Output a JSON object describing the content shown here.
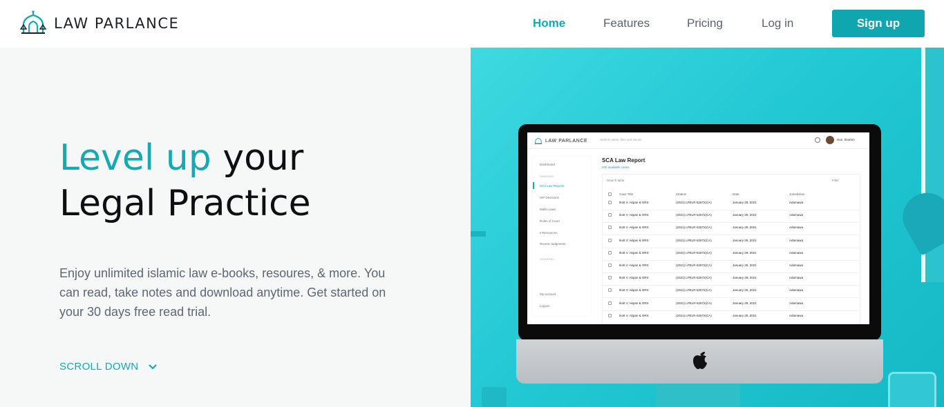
{
  "header": {
    "brand": "LAW PARLANCE",
    "nav": [
      {
        "label": "Home",
        "active": true
      },
      {
        "label": "Features",
        "active": false
      },
      {
        "label": "Pricing",
        "active": false
      },
      {
        "label": "Log in",
        "active": false
      }
    ],
    "signup_label": "Sign up"
  },
  "hero": {
    "headline_highlight": "Level up",
    "headline_rest": "your",
    "headline_line2": "Legal Practice",
    "description": "Enjoy unlimited islamic law e-books, resoures, & more. You can read, take notes and download anytime. Get started on your 30 days free read trial.",
    "scroll_label": "SCROLL DOWN"
  },
  "screen": {
    "brand": "LAW PARLANCE",
    "search_placeholder": "Search cases, files and issues",
    "user_name": "Hon. Ibrahim",
    "sidebar": {
      "dashboard": "Dashboard",
      "section_sharia": "SHARIAH",
      "items": [
        "SCA Law Reports",
        "ISP Decisions",
        "Maliki Laws",
        "Rules of Court",
        "e-Resources",
        "Recent Judgments"
      ],
      "section_general": "GENERAL",
      "my_account": "My Account",
      "logout": "Logout"
    },
    "page_title": "SCA Law Report",
    "page_sub": "200 available cases",
    "table_search": "Search table",
    "filter": "Filter",
    "columns": [
      "Case Title",
      "Citation",
      "Date",
      "Jurisdiction"
    ],
    "rows": [
      [
        "Ikott V. Akpan & ORS",
        "(2021) LPELR-52672(CA)",
        "January 29, 2021",
        "Adamawa"
      ],
      [
        "Ikott V. Akpan & ORS",
        "(2021) LPELR-52672(CA)",
        "January 29, 2021",
        "Adamawa"
      ],
      [
        "Ikott V. Akpan & ORS",
        "(2021) LPELR-52672(CA)",
        "January 29, 2021",
        "Adamawa"
      ],
      [
        "Ikott V. Akpan & ORS",
        "(2021) LPELR-52672(CA)",
        "January 29, 2021",
        "Adamawa"
      ],
      [
        "Ikott V. Akpan & ORS",
        "(2021) LPELR-52672(CA)",
        "January 29, 2021",
        "Adamawa"
      ],
      [
        "Ikott V. Akpan & ORS",
        "(2021) LPELR-52672(CA)",
        "January 29, 2021",
        "Adamawa"
      ],
      [
        "Ikott V. Akpan & ORS",
        "(2021) LPELR-52672(CA)",
        "January 29, 2021",
        "Adamawa"
      ],
      [
        "Ikott V. Akpan & ORS",
        "(2021) LPELR-52672(CA)",
        "January 29, 2021",
        "Adamawa"
      ],
      [
        "Ikott V. Akpan & ORS",
        "(2021) LPELR-52672(CA)",
        "January 29, 2021",
        "Adamawa"
      ],
      [
        "Ikott V. Akpan & ORS",
        "(2021) LPELR-52672(CA)",
        "January 29, 2021",
        "Adamawa"
      ]
    ]
  },
  "colors": {
    "accent": "#14a8b5",
    "button": "#0fa6b0",
    "hero_bg": "#22c8d4",
    "left_bg": "#f6f7f7"
  }
}
